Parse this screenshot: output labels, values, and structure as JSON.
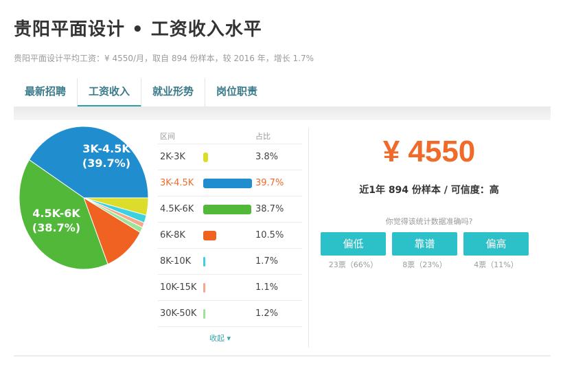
{
  "header": {
    "title": "贵阳平面设计 • 工资收入水平",
    "subtitle": "贵阳平面设计平均工资：¥ 4550/月，取自 894 份样本，较 2016 年，增长 1.7%"
  },
  "tabs": [
    {
      "label": "最新招聘",
      "active": false
    },
    {
      "label": "工资收入",
      "active": true
    },
    {
      "label": "就业形势",
      "active": false
    },
    {
      "label": "岗位职责",
      "active": false
    }
  ],
  "chart_data": {
    "type": "pie",
    "categories": [
      "2K-3K",
      "3K-4.5K",
      "4.5K-6K",
      "6K-8K",
      "8K-10K",
      "10K-15K",
      "30K-50K"
    ],
    "values": [
      3.8,
      39.7,
      38.7,
      10.5,
      1.7,
      1.1,
      1.2
    ],
    "colors": [
      "#dcdc2a",
      "#1f8dce",
      "#52b83a",
      "#f06221",
      "#3cd1e0",
      "#f4a98a",
      "#9ee39a"
    ],
    "labels": [
      {
        "range": "3K-4.5K",
        "pct": "(39.7%)"
      },
      {
        "range": "4.5K-6K",
        "pct": "(38.7%)"
      }
    ]
  },
  "table": {
    "header_range": "区间",
    "header_pct": "占比",
    "rows": [
      {
        "range": "2K-3K",
        "pct": "3.8%",
        "value": 3.8,
        "color": "#dcdc2a",
        "highlight": false
      },
      {
        "range": "3K-4.5K",
        "pct": "39.7%",
        "value": 39.7,
        "color": "#1f8dce",
        "highlight": true
      },
      {
        "range": "4.5K-6K",
        "pct": "38.7%",
        "value": 38.7,
        "color": "#52b83a",
        "highlight": false
      },
      {
        "range": "6K-8K",
        "pct": "10.5%",
        "value": 10.5,
        "color": "#f06221",
        "highlight": false
      },
      {
        "range": "8K-10K",
        "pct": "1.7%",
        "value": 1.7,
        "color": "#3cd1e0",
        "highlight": false
      },
      {
        "range": "10K-15K",
        "pct": "1.1%",
        "value": 1.1,
        "color": "#f4a98a",
        "highlight": false
      },
      {
        "range": "30K-50K",
        "pct": "1.2%",
        "value": 1.2,
        "color": "#9ee39a",
        "highlight": false
      }
    ],
    "collapse_label": "收起"
  },
  "summary": {
    "avg_salary": "¥ 4550",
    "sample_line": "近1年 894 份样本 / 可信度：高",
    "question": "你觉得该统计数据准确吗?"
  },
  "votes": [
    {
      "label": "偏低",
      "count": "23票（66%）"
    },
    {
      "label": "靠谱",
      "count": "8票（23%）"
    },
    {
      "label": "偏高",
      "count": "4票（11%）"
    }
  ],
  "colors": {
    "accent": "#2cc1c8",
    "highlight": "#f06a29",
    "tab_text": "#3a7a8a"
  }
}
